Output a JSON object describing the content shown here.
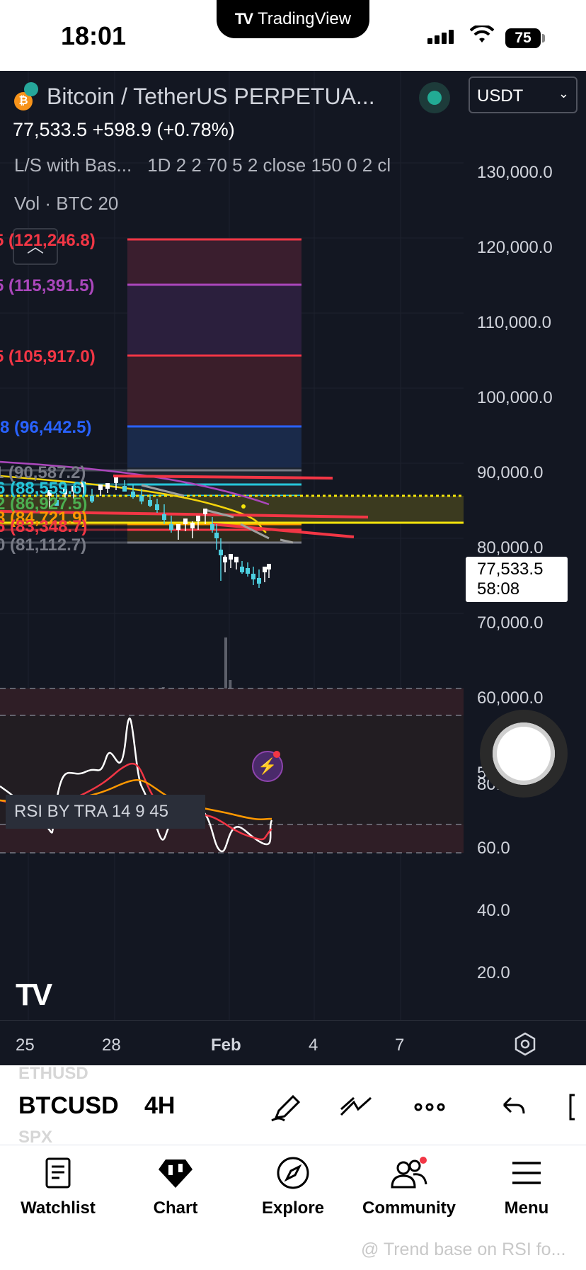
{
  "status_bar": {
    "time": "18:01",
    "app_pill": "TradingView",
    "battery": "75"
  },
  "header": {
    "symbol_title": "Bitcoin / TetherUS PERPETUA...",
    "coin_icon": "₿",
    "currency": "USDT",
    "last_price": "77,533.5",
    "change": "+598.9 (+0.78%)",
    "indicator_1_name": "L/S with Bas...",
    "indicator_1_params": "1D 2 2 70 5 2 close 150 0 2 cl",
    "volume_label": "Vol · BTC 20",
    "rsi_label": "RSI BY TRA 14 9 45"
  },
  "price_axis": [
    "130,000.0",
    "120,000.0",
    "110,000.0",
    "100,000.0",
    "90,000.0",
    "80,000.0",
    "70,000.0",
    "60,000.0",
    "50,000.0"
  ],
  "rsi_axis": [
    "80.0",
    "60.0",
    "40.0",
    "20.0"
  ],
  "price_box": {
    "price": "77,533.5",
    "countdown": "58:08"
  },
  "fib_levels": [
    {
      "text": "5 (121,246.8)",
      "color": "#f23645"
    },
    {
      "text": "5 (115,391.5)",
      "color": "#ab47bc"
    },
    {
      "text": "5 (105,917.0)",
      "color": "#f23645"
    },
    {
      "text": "8 (96,442.5)",
      "color": "#2962ff"
    },
    {
      "text": "1 (90,587.2)",
      "color": "#787b86"
    },
    {
      "text": "6 (88,559.6)",
      "color": "#26c6da"
    },
    {
      "text": "2 (86,927.5)",
      "color": "#4caf50"
    },
    {
      "text": "8 (84,721.9)",
      "color": "#ff9800"
    },
    {
      "text": "6 (83,348.7)",
      "color": "#f23645"
    },
    {
      "text": "0 (81,112.7)",
      "color": "#787b86"
    }
  ],
  "time_axis": [
    "25",
    "28",
    "Feb",
    "4",
    "7"
  ],
  "toolbar": {
    "symbol_prev": "ETHUSD",
    "symbol": "BTCUSD",
    "symbol_next": "SPX",
    "interval": "4H"
  },
  "nav": [
    {
      "label": "Watchlist",
      "icon": "watchlist-icon"
    },
    {
      "label": "Chart",
      "icon": "chart-icon"
    },
    {
      "label": "Explore",
      "icon": "compass-icon"
    },
    {
      "label": "Community",
      "icon": "community-icon"
    },
    {
      "label": "Menu",
      "icon": "menu-icon"
    }
  ],
  "watermark": "@ Trend base on RSI fo...",
  "colors": {
    "background": "#131722",
    "up": "#ffffff",
    "down": "#4dd0e1",
    "current_price": "#f5e50b",
    "rsi_line": "#ffffff"
  }
}
